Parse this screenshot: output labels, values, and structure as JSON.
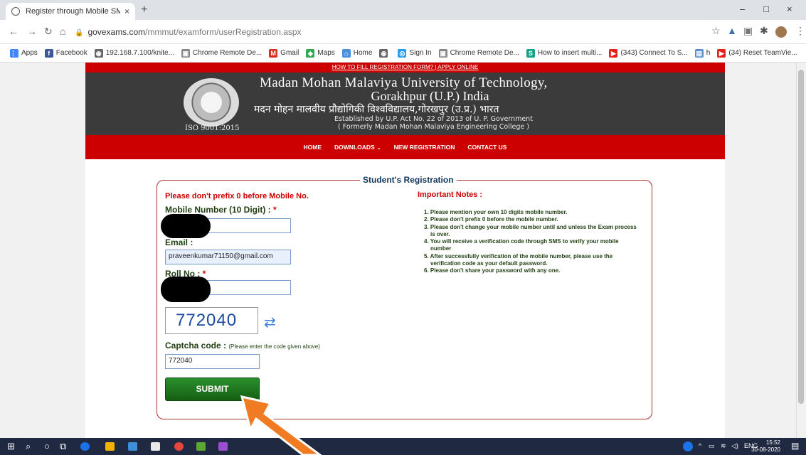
{
  "browser": {
    "tab_title": "Register through Mobile SMS.",
    "tab_close": "×",
    "new_tab": "+",
    "url_domain": "govexams.com",
    "url_path": "/mmmut/examform/userRegistration.aspx",
    "window_controls": [
      "–",
      "□",
      "×"
    ]
  },
  "bookmarks": [
    {
      "label": "Apps",
      "color": "#4285f4",
      "glyph": "⋮⋮"
    },
    {
      "label": "Facebook",
      "color": "#3b5998",
      "glyph": "f"
    },
    {
      "label": "192.168.7.100/knite...",
      "color": "#666666",
      "glyph": "◉"
    },
    {
      "label": "Chrome Remote De...",
      "color": "#888888",
      "glyph": "▣"
    },
    {
      "label": "Gmail",
      "color": "#d93025",
      "glyph": "M"
    },
    {
      "label": "Maps",
      "color": "#34a853",
      "glyph": "◆"
    },
    {
      "label": "Home",
      "color": "#4a90d9",
      "glyph": "⌂"
    },
    {
      "label": "",
      "color": "#666666",
      "glyph": "◉"
    },
    {
      "label": "Sign In",
      "color": "#2a9df4",
      "glyph": "◎"
    },
    {
      "label": "Chrome Remote De...",
      "color": "#888888",
      "glyph": "▣"
    },
    {
      "label": "How to insert multi...",
      "color": "#16a085",
      "glyph": "S"
    },
    {
      "label": "(343) Connect To S...",
      "color": "#e62117",
      "glyph": "▶"
    },
    {
      "label": "h",
      "color": "#5b8fd1",
      "glyph": "▤"
    },
    {
      "label": "(34) Reset TeamVie...",
      "color": "#e62117",
      "glyph": "▶"
    }
  ],
  "site": {
    "top_links": "HOW TO FILL REGISTRATION FORM? | APPLY ONLINE",
    "uni_name_line1": "Madan Mohan Malaviya University of Technology,",
    "uni_name_line2": "Gorakhpur (U.P.) India",
    "uni_name_hindi": "मदन मोहन मालवीय प्रौद्योगिकी विश्वविद्यालय,गोरखपुर (उ.प्र.) भारत",
    "established": "Established by U.P. Act No. 22 of 2013 of U. P. Government",
    "formerly": "( Formerly Madan Mohan Malaviya Engineering College )",
    "iso": "ISO 9001:2015",
    "nav": [
      "HOME",
      "DOWNLOADS",
      "NEW REGISTRATION",
      "CONTACT US"
    ]
  },
  "form": {
    "legend": "Student's Registration",
    "warning": "Please don't prefix 0 before Mobile No.",
    "mobile_label": "Mobile Number (10 Digit) : ",
    "email_label": "Email :",
    "email_value": "praveenkumar71150@gmail.com",
    "roll_label": "Roll No : ",
    "required_mark": "*",
    "captcha_text": "772040",
    "captcha_label": "Captcha code : ",
    "captcha_hint": "(Please enter the code given above)",
    "captcha_value": "772040",
    "submit_label": "SUBMIT"
  },
  "notes": {
    "title": "Important Notes :",
    "items": [
      "1. Please mention your own 10 digits mobile number.",
      "2. Please don't prefix 0 before the mobile number.",
      "3. Please don't change your mobile number until and unless the Exam process is over.",
      "4. You will receive a verification code through SMS to verify your mobile number",
      "5. After successfully verification of the mobile number, please use the verification code as your default password.",
      "6. Please don't share your password with any one."
    ]
  },
  "taskbar": {
    "time": "15:52",
    "date": "30-08-2020",
    "lang": "ENG"
  },
  "colors": {
    "site_red": "#cc0000",
    "banner_dark": "#3b3b3b",
    "submit_green": "#1e7a1e",
    "label_green": "#1f3f10",
    "arrow_orange": "#f07b22"
  }
}
